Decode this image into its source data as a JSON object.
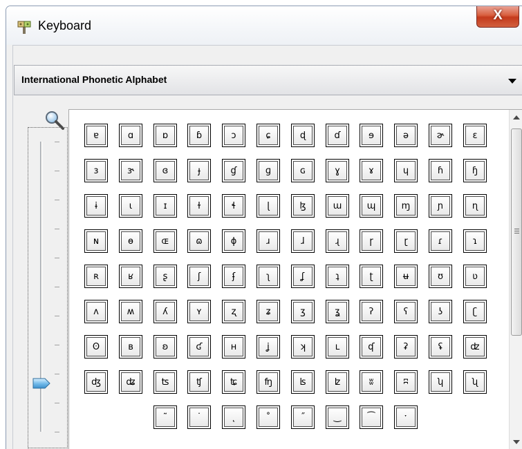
{
  "window": {
    "title": "Keyboard",
    "close_label": "X"
  },
  "alphabet_select": {
    "value": "International Phonetic Alphabet"
  },
  "icons": {
    "app": "keyboard-app-icon",
    "zoom": "magnifier-icon",
    "close": "close-icon",
    "dropdown": "chevron-down-icon"
  },
  "colors": {
    "close_button": "#c43a1c",
    "slider_thumb": "#6fb8e8",
    "window_border": "#8b9bb3"
  },
  "zoom_slider": {
    "level": 0.15
  },
  "keys": [
    [
      "ɐ",
      "ɑ",
      "ɒ",
      "ɓ",
      "ɔ",
      "ɕ",
      "ɖ",
      "ɗ",
      "ɘ",
      "ə",
      "ɚ",
      "ɛ"
    ],
    [
      "ɜ",
      "ɝ",
      "ɞ",
      "ɟ",
      "ɠ",
      "ɡ",
      "ɢ",
      "ɣ",
      "ɤ",
      "ɥ",
      "ɦ",
      "ɧ"
    ],
    [
      "ɨ",
      "ɩ",
      "ɪ",
      "ɫ",
      "ɬ",
      "ɭ",
      "ɮ",
      "ɯ",
      "ɰ",
      "ɱ",
      "ɲ",
      "ɳ"
    ],
    [
      "ɴ",
      "ɵ",
      "ɶ",
      "ɷ",
      "ɸ",
      "ɹ",
      "ɺ",
      "ɻ",
      "ɼ",
      "ɽ",
      "ɾ",
      "ɿ"
    ],
    [
      "ʀ",
      "ʁ",
      "ʂ",
      "ʃ",
      "ʄ",
      "ʅ",
      "ʆ",
      "ʇ",
      "ʈ",
      "ʉ",
      "ʊ",
      "ʋ"
    ],
    [
      "ʌ",
      "ʍ",
      "ʎ",
      "ʏ",
      "ʐ",
      "ʑ",
      "ʒ",
      "ʓ",
      "ʔ",
      "ʕ",
      "ʖ",
      "ʗ"
    ],
    [
      "ʘ",
      "ʙ",
      "ʚ",
      "ʛ",
      "ʜ",
      "ʝ",
      "ʞ",
      "ʟ",
      "ʠ",
      "ʡ",
      "ʢ",
      "ʣ"
    ],
    [
      "ʤ",
      "ʥ",
      "ʦ",
      "ʧ",
      "ʨ",
      "ʩ",
      "ʪ",
      "ʫ",
      "ʬ",
      "ʭ",
      "ʮ",
      "ʯ"
    ],
    [
      "˜",
      "˙",
      "˛",
      "˚",
      "˝",
      "‿",
      "⁀",
      "ˑ"
    ]
  ]
}
